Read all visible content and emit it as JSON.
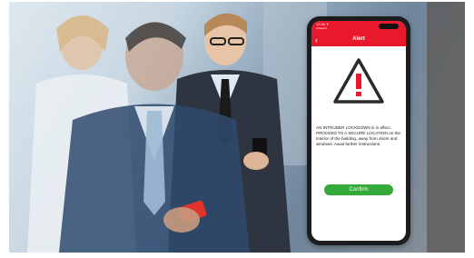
{
  "phone": {
    "status_time": "12:34 ✦",
    "status_sub": "◂ Search",
    "nav_back": "‹",
    "title": "Alert",
    "message": "AN INTRUDER LOCKDOWN is in effect. PROCEED TO A SECURE LOCATION on the interior of the building, away from doors and windows. Await further instructions.",
    "confirm_label": "Confirm"
  },
  "colors": {
    "accent": "#e8192c",
    "confirm": "#33aa3a",
    "warning_icon_fill": "#e8192c"
  },
  "icons": {
    "warning": "warning-triangle-icon",
    "back": "chevron-left-icon"
  }
}
